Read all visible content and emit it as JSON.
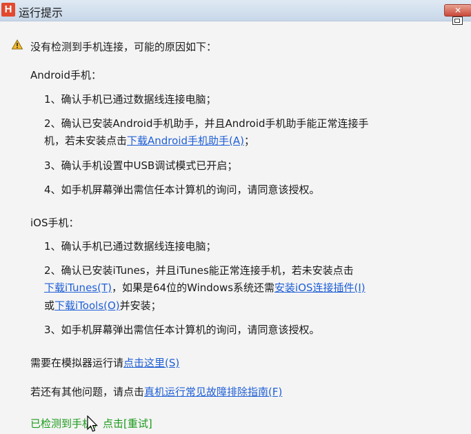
{
  "window": {
    "logo": "H",
    "title": "运行提示",
    "close_label": "✕"
  },
  "header": {
    "message": "没有检测到手机连接，可能的原因如下："
  },
  "android": {
    "heading": "Android手机：",
    "item1": "1、确认手机已通过数据线连接电脑；",
    "item2_line1": "2、确认已安装Android手机助手，并且Android手机助手能正常连接手",
    "item2_prefix": "机，若未安装点击",
    "item2_link": "下载Android手机助手(A)",
    "item2_suffix": "；",
    "item3": "3、确认手机设置中USB调试模式已开启；",
    "item4": "4、如手机屏幕弹出需信任本计算机的询问，请同意该授权。"
  },
  "ios": {
    "heading": "iOS手机：",
    "item1": "1、确认手机已通过数据线连接电脑；",
    "item2_line1": "2、确认已安装iTunes，并且iTunes能正常连接手机，若未安装点击",
    "item2_link1": "下载iTunes(T)",
    "item2_mid": "，如果是64位的Windows系统还需",
    "item2_link2": "安装iOS连接插件(I)",
    "item2_or": "或",
    "item2_link3": "下载iTools(O)",
    "item2_end": "并安装；",
    "item3": "3、如手机屏幕弹出需信任本计算机的询问，请同意该授权。"
  },
  "emulator": {
    "prefix": "需要在模拟器运行请",
    "link": "点击这里(S)"
  },
  "help": {
    "prefix": "若还有其他问题，请点击",
    "link": "真机运行常见故障排除指南(F)"
  },
  "status": {
    "text": "已检测到手机，点击[重试]"
  },
  "colors": {
    "link": "#1f5fd6",
    "success": "#1b9a1b",
    "logo": "#e2492f"
  }
}
